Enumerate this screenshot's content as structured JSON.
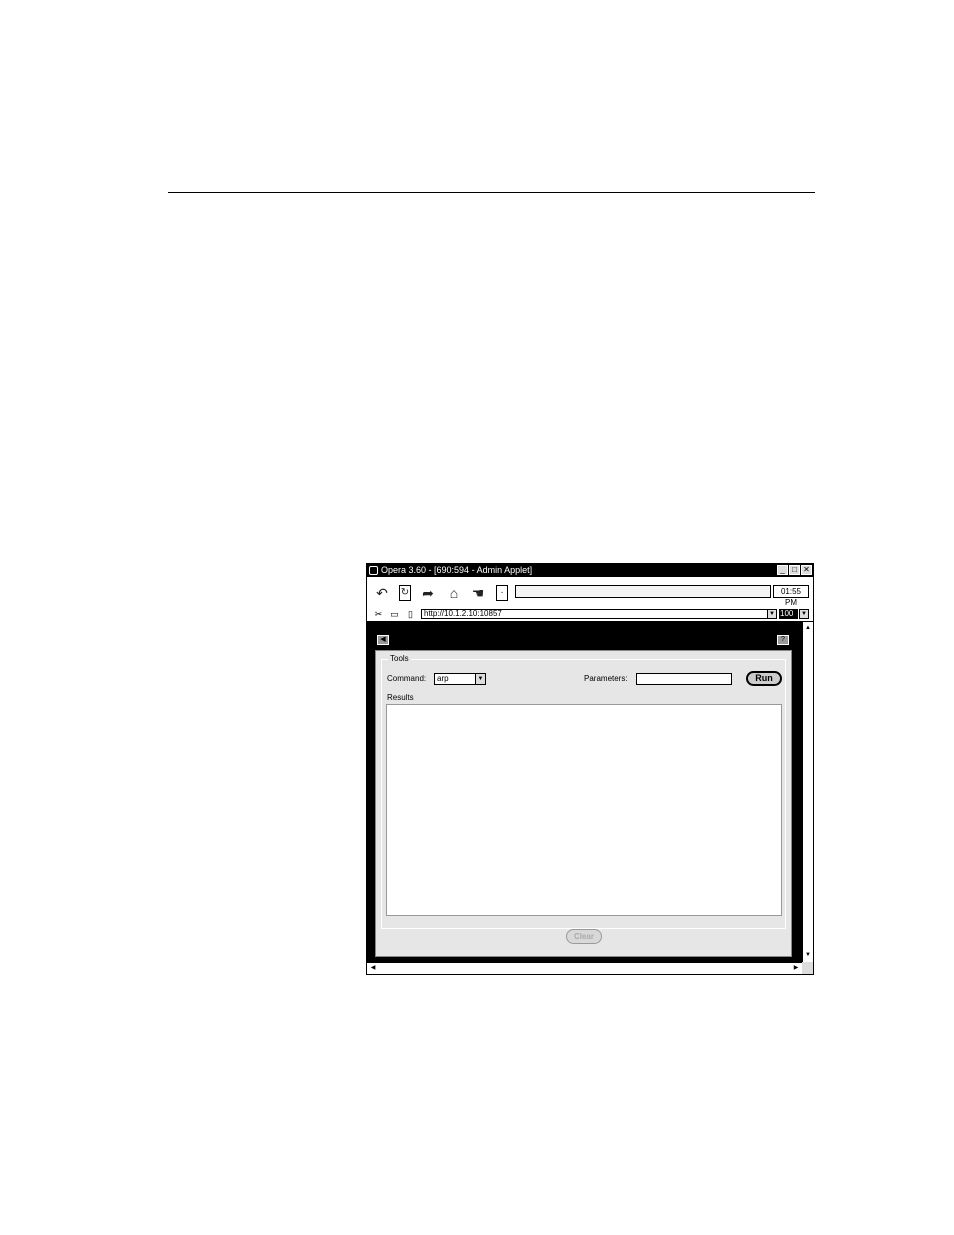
{
  "window": {
    "title": "Opera 3.60 - [690:594 - Admin Applet]",
    "minimize": "_",
    "maximize": "□",
    "close": "✕"
  },
  "toolbar": {
    "icons": [
      "back-icon",
      "reload-icon",
      "forward-icon",
      "home-icon",
      "hotlist-icon",
      "document-icon"
    ],
    "time": "01:55 PM"
  },
  "address": {
    "url": "http://10.1.2.10:10857",
    "zoom": "100"
  },
  "applet": {
    "back_glyph": "◀",
    "help_glyph": "?",
    "group_title": "Tools",
    "command_label": "Command:",
    "command_value": "arp",
    "parameters_label": "Parameters:",
    "parameters_value": "",
    "run_label": "Run",
    "results_label": "Results",
    "clear_label": "Clear"
  },
  "colors": {
    "chrome": "#000000",
    "panel": "#e6e6e6"
  }
}
